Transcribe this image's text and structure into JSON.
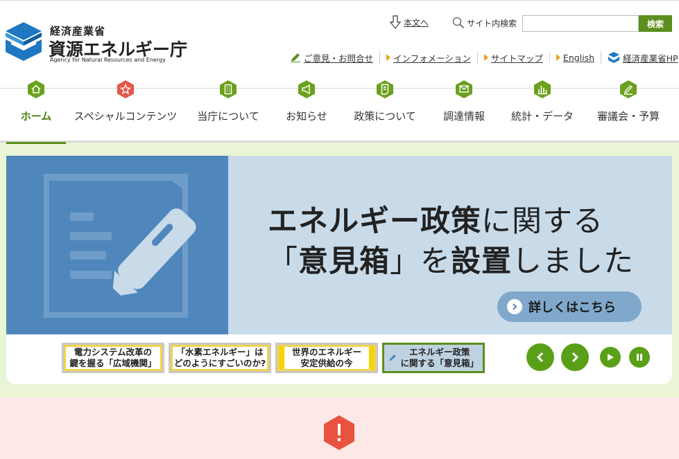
{
  "header": {
    "org": "経済産業省",
    "agency_name": "資源エネルギー庁",
    "agency_name_en": "Agency for Natural Resources and Energy",
    "skip_link": "本文へ",
    "search": {
      "label": "サイト内検索",
      "placeholder": "",
      "button": "検索"
    },
    "util_links": [
      {
        "label": "ご意見・お問合せ",
        "icon": "pencil-icon"
      },
      {
        "label": "インフォメーション",
        "icon": "triangle-icon"
      },
      {
        "label": "サイトマップ",
        "icon": "triangle-icon"
      },
      {
        "label": "English",
        "icon": "triangle-icon"
      },
      {
        "label": "経済産業省HP",
        "icon": "meti-logo-icon"
      }
    ]
  },
  "nav": {
    "items": [
      {
        "label": "ホーム",
        "icon": "home-icon",
        "active": true
      },
      {
        "label": "スペシャルコンテンツ",
        "icon": "star-icon"
      },
      {
        "label": "当庁について",
        "icon": "building-icon"
      },
      {
        "label": "お知らせ",
        "icon": "megaphone-icon"
      },
      {
        "label": "政策について",
        "icon": "document-icon"
      },
      {
        "label": "調達情報",
        "icon": "mail-icon"
      },
      {
        "label": "統計・データ",
        "icon": "bar-chart-icon"
      },
      {
        "label": "審議会・予算",
        "icon": "edit-icon"
      }
    ]
  },
  "banner": {
    "line1_bold": "エネルギー政策",
    "line1_rest": "に関する",
    "line2_open": "「",
    "line2_bold": "意見箱",
    "line2_mid": "」を",
    "line2_bold2": "設置",
    "line2_rest": "しました",
    "detail_button": "詳しくはこちら"
  },
  "thumbnails": [
    {
      "line1": "電力システム改革の",
      "line2": "鍵を握る「広域機関」"
    },
    {
      "line1": "「水素エネルギー」は",
      "line2": "どのようにすごいのか?"
    },
    {
      "line1": "世界のエネルギー",
      "line2": "安定供給の今"
    },
    {
      "line1": "エネルギー政策",
      "line2": "に関する「意見箱」"
    }
  ],
  "carousel_controls": [
    "previous",
    "next",
    "play",
    "pause"
  ],
  "colors": {
    "brand_green": "#5a8f1e",
    "nav_icon_green": "#6aa11e",
    "special_red": "#e4584a",
    "hero_bg": "#e9f5d5",
    "banner_blue": "#4f87bc",
    "banner_light": "#c9dbe9",
    "alert_bg": "#fde8e6",
    "alert_red": "#e8533f"
  }
}
